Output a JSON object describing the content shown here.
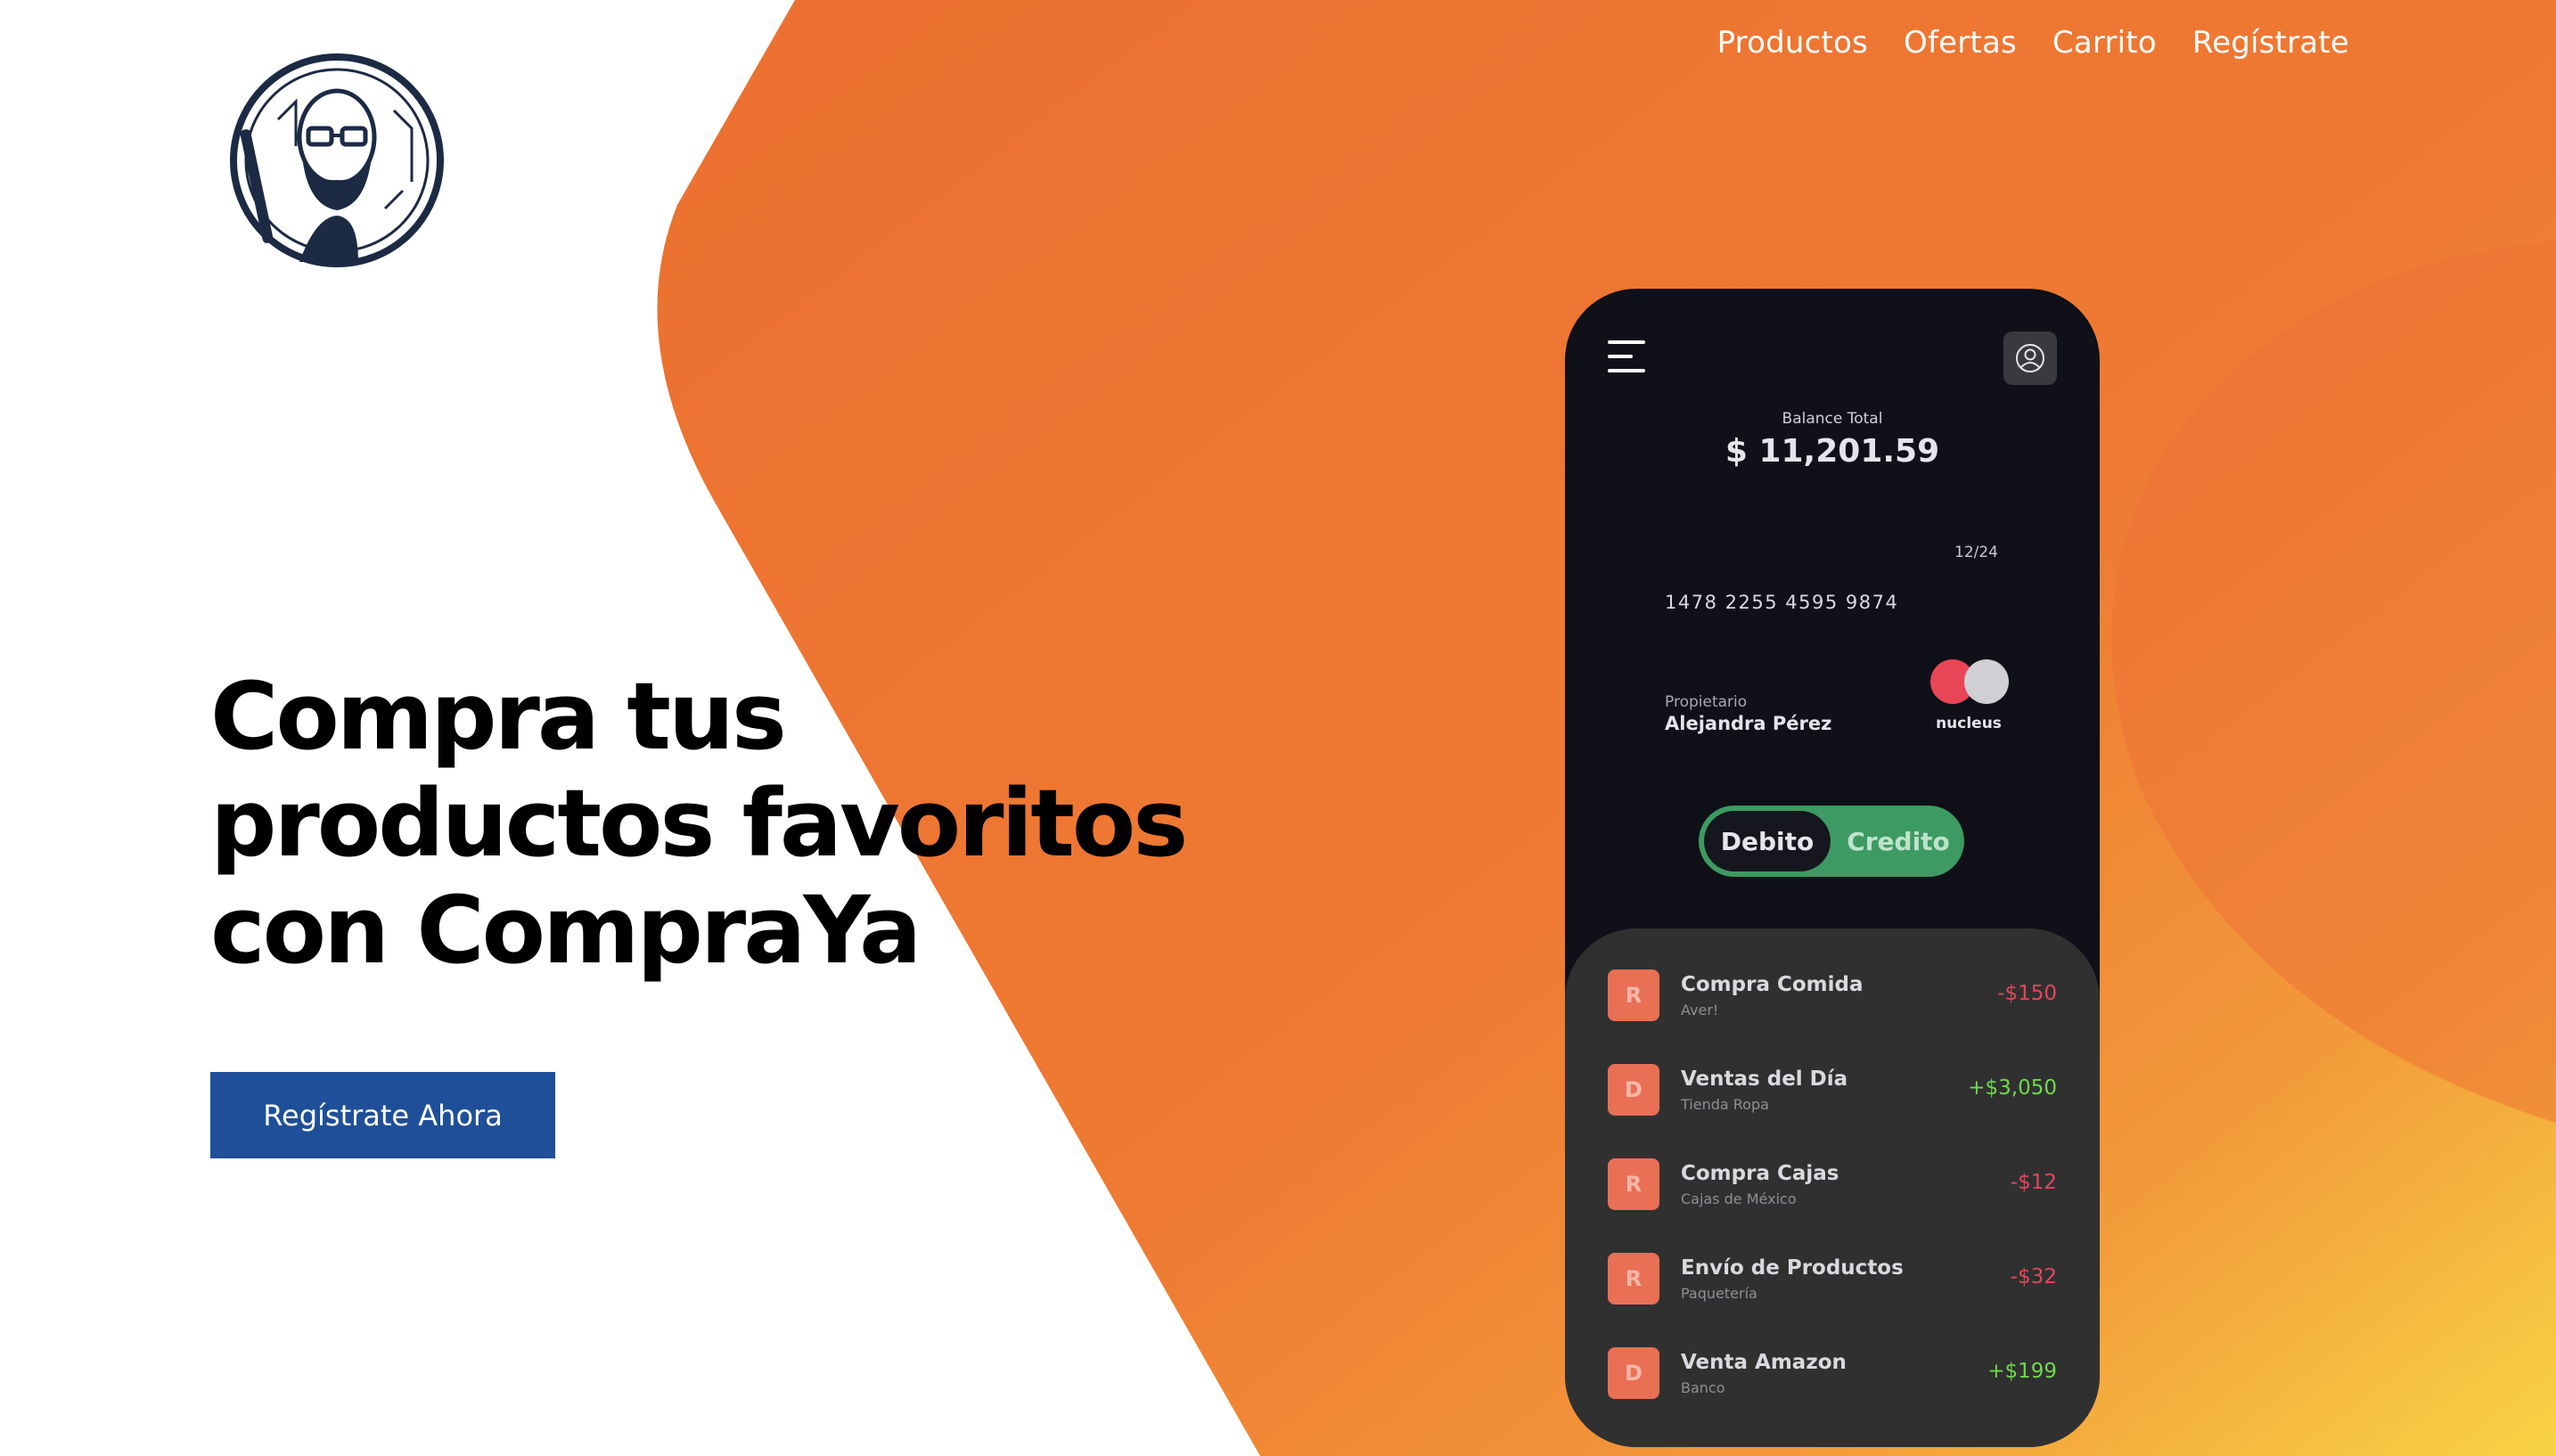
{
  "nav": {
    "items": [
      "Productos",
      "Ofertas",
      "Carrito",
      "Regístrate"
    ]
  },
  "hero": {
    "title_lines": [
      "Compra tus",
      "productos favoritos",
      "con CompraYa"
    ],
    "cta_label": "Regístrate Ahora"
  },
  "phone": {
    "balance_label": "Balance Total",
    "balance_value": "$ 11,201.59",
    "card": {
      "expiry": "12/24",
      "number": "1478 2255 4595 9874",
      "owner_label": "Propietario",
      "owner_name": "Alejandra Pérez",
      "brand": "nucleus"
    },
    "toggle": {
      "debit_label": "Debito",
      "credit_label": "Credito"
    },
    "transactions": [
      {
        "badge": "R",
        "title": "Compra Comida",
        "subtitle": "Aver!",
        "amount": "-$150",
        "kind": "neg"
      },
      {
        "badge": "D",
        "title": "Ventas del Día",
        "subtitle": "Tienda Ropa",
        "amount": "+$3,050",
        "kind": "pos"
      },
      {
        "badge": "R",
        "title": "Compra Cajas",
        "subtitle": "Cajas de México",
        "amount": "-$12",
        "kind": "neg"
      },
      {
        "badge": "R",
        "title": "Envío de Productos",
        "subtitle": "Paquetería",
        "amount": "-$32",
        "kind": "neg"
      },
      {
        "badge": "D",
        "title": "Venta Amazon",
        "subtitle": "Banco",
        "amount": "+$199",
        "kind": "pos"
      }
    ]
  },
  "colors": {
    "orange": "#ed7431",
    "yellow": "#f7d542",
    "cta_blue": "#1f4f99",
    "phone_bg": "#0f1018",
    "toggle_green": "#3d9a62",
    "badge": "#e96f55",
    "negative": "#e2475b",
    "positive": "#6fd94c"
  },
  "icons": [
    "logo-portrait-icon",
    "menu-icon",
    "user-icon",
    "card-brand-circles-icon"
  ]
}
